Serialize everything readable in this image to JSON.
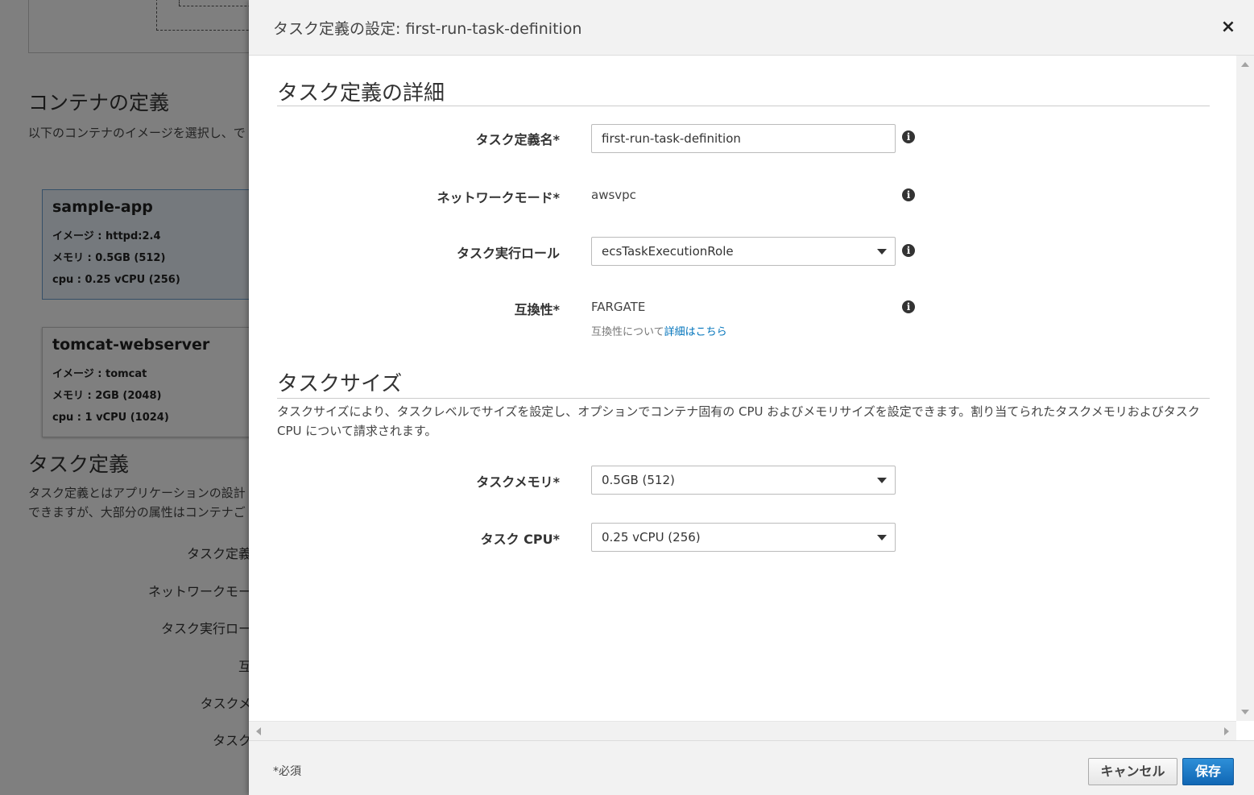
{
  "background": {
    "container_heading": "コンテナの定義",
    "container_desc": "以下のコンテナのイメージを選択し、で",
    "cards": [
      {
        "title": "sample-app",
        "image": "イメージ : httpd:2.4",
        "memory": "メモリ :  0.5GB (512)",
        "cpu": "cpu :  0.25 vCPU (256)"
      },
      {
        "title": "tomcat-webserver",
        "image": "イメージ : tomcat",
        "memory": "メモリ :  2GB (2048)",
        "cpu": "cpu :  1 vCPU (1024)"
      }
    ],
    "task_heading": "タスク定義",
    "task_desc_1": "タスク定義とはアプリケーションの設計",
    "task_desc_2": "できますが、大部分の属性はコンテナご",
    "labels": [
      "タスク定義",
      "ネットワークモー",
      "タスク実行ロー",
      "互",
      "タスクメ",
      "タスク"
    ]
  },
  "modal": {
    "title": "タスク定義の設定: first-run-task-definition",
    "close_icon": "×",
    "details_heading": "タスク定義の詳細",
    "fields": {
      "task_name_label": "タスク定義名*",
      "task_name_value": "first-run-task-definition",
      "network_mode_label": "ネットワークモード*",
      "network_mode_value": "awsvpc",
      "exec_role_label": "タスク実行ロール",
      "exec_role_value": "ecsTaskExecutionRole",
      "compat_label": "互換性*",
      "compat_value": "FARGATE",
      "compat_help_prefix": "互換性について",
      "compat_help_link": "詳細はこちら"
    },
    "size_heading": "タスクサイズ",
    "size_desc": "タスクサイズにより、タスクレベルでサイズを設定し、オプションでコンテナ固有の CPU およびメモリサイズを設定できます。割り当てられたタスクメモリおよびタスク CPU について請求されます。",
    "size_fields": {
      "memory_label": "タスクメモリ*",
      "memory_value": "0.5GB (512)",
      "cpu_label": "タスク CPU*",
      "cpu_value": "0.25 vCPU (256)"
    },
    "info_icon_glyph": "i",
    "footer": {
      "required_note": "*必須",
      "cancel_label": "キャンセル",
      "save_label": "保存"
    }
  }
}
